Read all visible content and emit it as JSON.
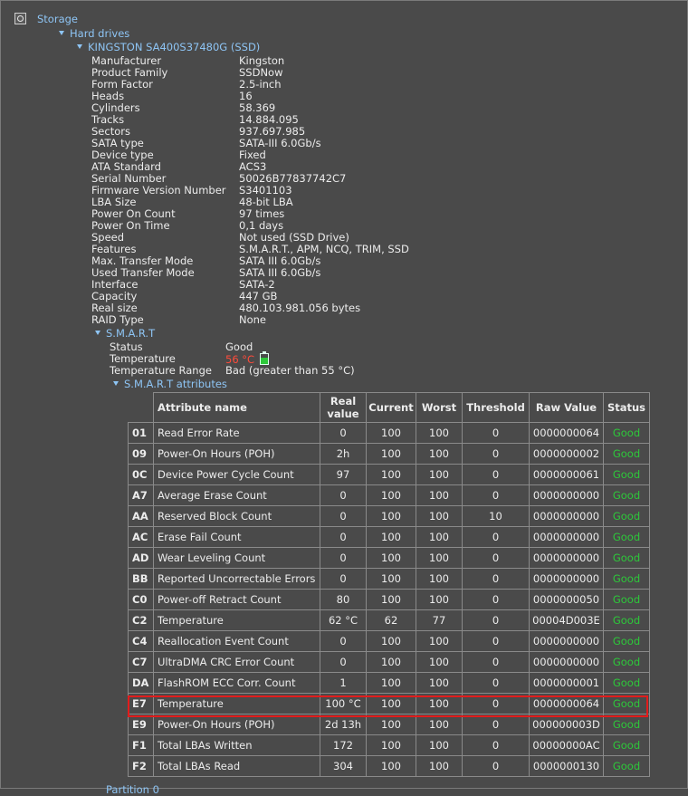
{
  "tree": {
    "storage": "Storage",
    "hard_drives": "Hard drives",
    "drive": "KINGSTON SA400S37480G (SSD)",
    "smart": "S.M.A.R.T",
    "smart_attributes": "S.M.A.R.T attributes",
    "partition": "Partition 0"
  },
  "props": [
    {
      "label": "Manufacturer",
      "value": "Kingston"
    },
    {
      "label": "Product Family",
      "value": "SSDNow"
    },
    {
      "label": "Form Factor",
      "value": "2.5-inch"
    },
    {
      "label": "Heads",
      "value": "16"
    },
    {
      "label": "Cylinders",
      "value": "58.369"
    },
    {
      "label": "Tracks",
      "value": "14.884.095"
    },
    {
      "label": "Sectors",
      "value": "937.697.985"
    },
    {
      "label": "SATA type",
      "value": "SATA-III 6.0Gb/s"
    },
    {
      "label": "Device type",
      "value": "Fixed"
    },
    {
      "label": "ATA Standard",
      "value": "ACS3"
    },
    {
      "label": "Serial Number",
      "value": "50026B77837742C7"
    },
    {
      "label": "Firmware Version Number",
      "value": "S3401103"
    },
    {
      "label": "LBA Size",
      "value": "48-bit LBA"
    },
    {
      "label": "Power On Count",
      "value": "97 times"
    },
    {
      "label": "Power On Time",
      "value": "0,1 days"
    },
    {
      "label": "Speed",
      "value": "Not used (SSD Drive)"
    },
    {
      "label": "Features",
      "value": "S.M.A.R.T., APM, NCQ, TRIM, SSD"
    },
    {
      "label": "Max. Transfer Mode",
      "value": "SATA III 6.0Gb/s"
    },
    {
      "label": "Used Transfer Mode",
      "value": "SATA III 6.0Gb/s"
    },
    {
      "label": "Interface",
      "value": "SATA-2"
    },
    {
      "label": "Capacity",
      "value": "447 GB"
    },
    {
      "label": "Real size",
      "value": "480.103.981.056 bytes"
    },
    {
      "label": "RAID Type",
      "value": "None"
    }
  ],
  "smart": {
    "status_label": "Status",
    "status_value": "Good",
    "temperature_label": "Temperature",
    "temperature_value": "56 °C",
    "temperature_range_label": "Temperature Range",
    "temperature_range_value": "Bad (greater than 55 °C)"
  },
  "table": {
    "headers": [
      "Attribute name",
      "Real value",
      "Current",
      "Worst",
      "Threshold",
      "Raw Value",
      "Status"
    ],
    "rows": [
      [
        "01",
        "Read Error Rate",
        "0",
        "100",
        "100",
        "0",
        "0000000064",
        "Good"
      ],
      [
        "09",
        "Power-On Hours (POH)",
        "2h",
        "100",
        "100",
        "0",
        "0000000002",
        "Good"
      ],
      [
        "0C",
        "Device Power Cycle Count",
        "97",
        "100",
        "100",
        "0",
        "0000000061",
        "Good"
      ],
      [
        "A7",
        "Average Erase Count",
        "0",
        "100",
        "100",
        "0",
        "0000000000",
        "Good"
      ],
      [
        "AA",
        "Reserved Block Count",
        "0",
        "100",
        "100",
        "10",
        "0000000000",
        "Good"
      ],
      [
        "AC",
        "Erase Fail Count",
        "0",
        "100",
        "100",
        "0",
        "0000000000",
        "Good"
      ],
      [
        "AD",
        "Wear Leveling Count",
        "0",
        "100",
        "100",
        "0",
        "0000000000",
        "Good"
      ],
      [
        "BB",
        "Reported Uncorrectable Errors",
        "0",
        "100",
        "100",
        "0",
        "0000000000",
        "Good"
      ],
      [
        "C0",
        "Power-off Retract Count",
        "80",
        "100",
        "100",
        "0",
        "0000000050",
        "Good"
      ],
      [
        "C2",
        "Temperature",
        "62 °C",
        "62",
        "77",
        "0",
        "00004D003E",
        "Good"
      ],
      [
        "C4",
        "Reallocation Event Count",
        "0",
        "100",
        "100",
        "0",
        "0000000000",
        "Good"
      ],
      [
        "C7",
        "UltraDMA CRC Error Count",
        "0",
        "100",
        "100",
        "0",
        "0000000000",
        "Good"
      ],
      [
        "DA",
        "FlashROM ECC Corr. Count",
        "1",
        "100",
        "100",
        "0",
        "0000000001",
        "Good"
      ],
      [
        "E7",
        "Temperature",
        "100 °C",
        "100",
        "100",
        "0",
        "0000000064",
        "Good"
      ],
      [
        "E9",
        "Power-On Hours (POH)",
        "2d 13h",
        "100",
        "100",
        "0",
        "000000003D",
        "Good"
      ],
      [
        "F1",
        "Total LBAs Written",
        "172",
        "100",
        "100",
        "0",
        "00000000AC",
        "Good"
      ],
      [
        "F2",
        "Total LBAs Read",
        "304",
        "100",
        "100",
        "0",
        "0000000130",
        "Good"
      ]
    ]
  },
  "colors": {
    "background": "#4a4a4a",
    "link": "#8ec5f5",
    "status_good": "#2dc83a",
    "temperature_hot": "#ff4a3a",
    "highlight_box": "#e21c1c"
  }
}
